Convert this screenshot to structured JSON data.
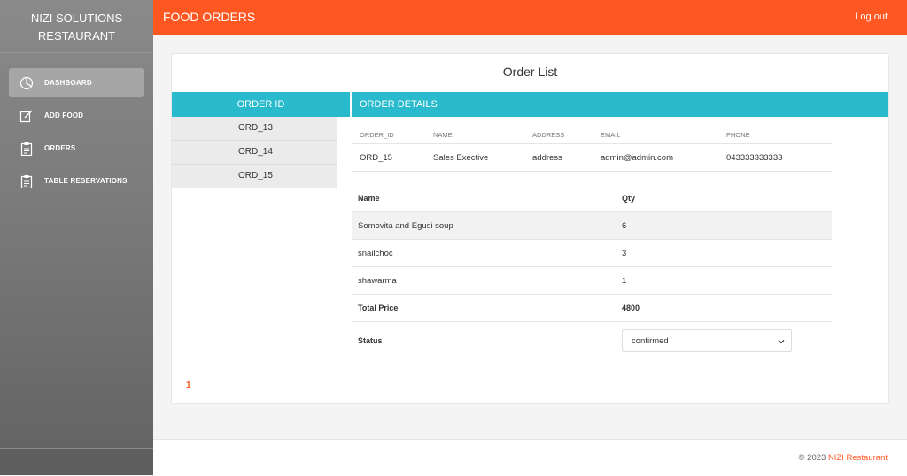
{
  "brand": {
    "line1": "NIZI SOLUTIONS",
    "line2": "RESTAURANT"
  },
  "sidebar": {
    "items": [
      {
        "label": "DASHBOARD",
        "icon": "pie-chart-icon",
        "active": true
      },
      {
        "label": "ADD FOOD",
        "icon": "edit-icon"
      },
      {
        "label": "ORDERS",
        "icon": "clipboard-icon"
      },
      {
        "label": "TABLE RESERVATIONS",
        "icon": "clipboard-icon"
      }
    ]
  },
  "header": {
    "title": "FOOD ORDERS",
    "logout": "Log out",
    "color": "#ff5722"
  },
  "card": {
    "title": "Order List",
    "col_order_id": "ORDER ID",
    "col_order_details": "ORDER DETAILS",
    "accent": "#29bbcd"
  },
  "orders": [
    "ORD_13",
    "ORD_14",
    "ORD_15"
  ],
  "details": {
    "headers": [
      "ORDER_ID",
      "NAME",
      "ADDRESS",
      "EMAIL",
      "PHONE"
    ],
    "row": [
      "ORD_15",
      "Sales Exective",
      "address",
      "admin@admin.com",
      "043333333333"
    ]
  },
  "items": {
    "header_name": "Name",
    "header_qty": "Qty",
    "rows": [
      {
        "name": "Somovita and Egusi soup",
        "qty": "6"
      },
      {
        "name": "snailchoc",
        "qty": "3"
      },
      {
        "name": "shawarma",
        "qty": "1"
      }
    ],
    "total_label": "Total Price",
    "total_value": "4800"
  },
  "status": {
    "label": "Status",
    "value": "confirmed"
  },
  "pagination": {
    "current": "1"
  },
  "footer": {
    "copy": "© 2023",
    "brand": "NIZI Restaurant"
  }
}
